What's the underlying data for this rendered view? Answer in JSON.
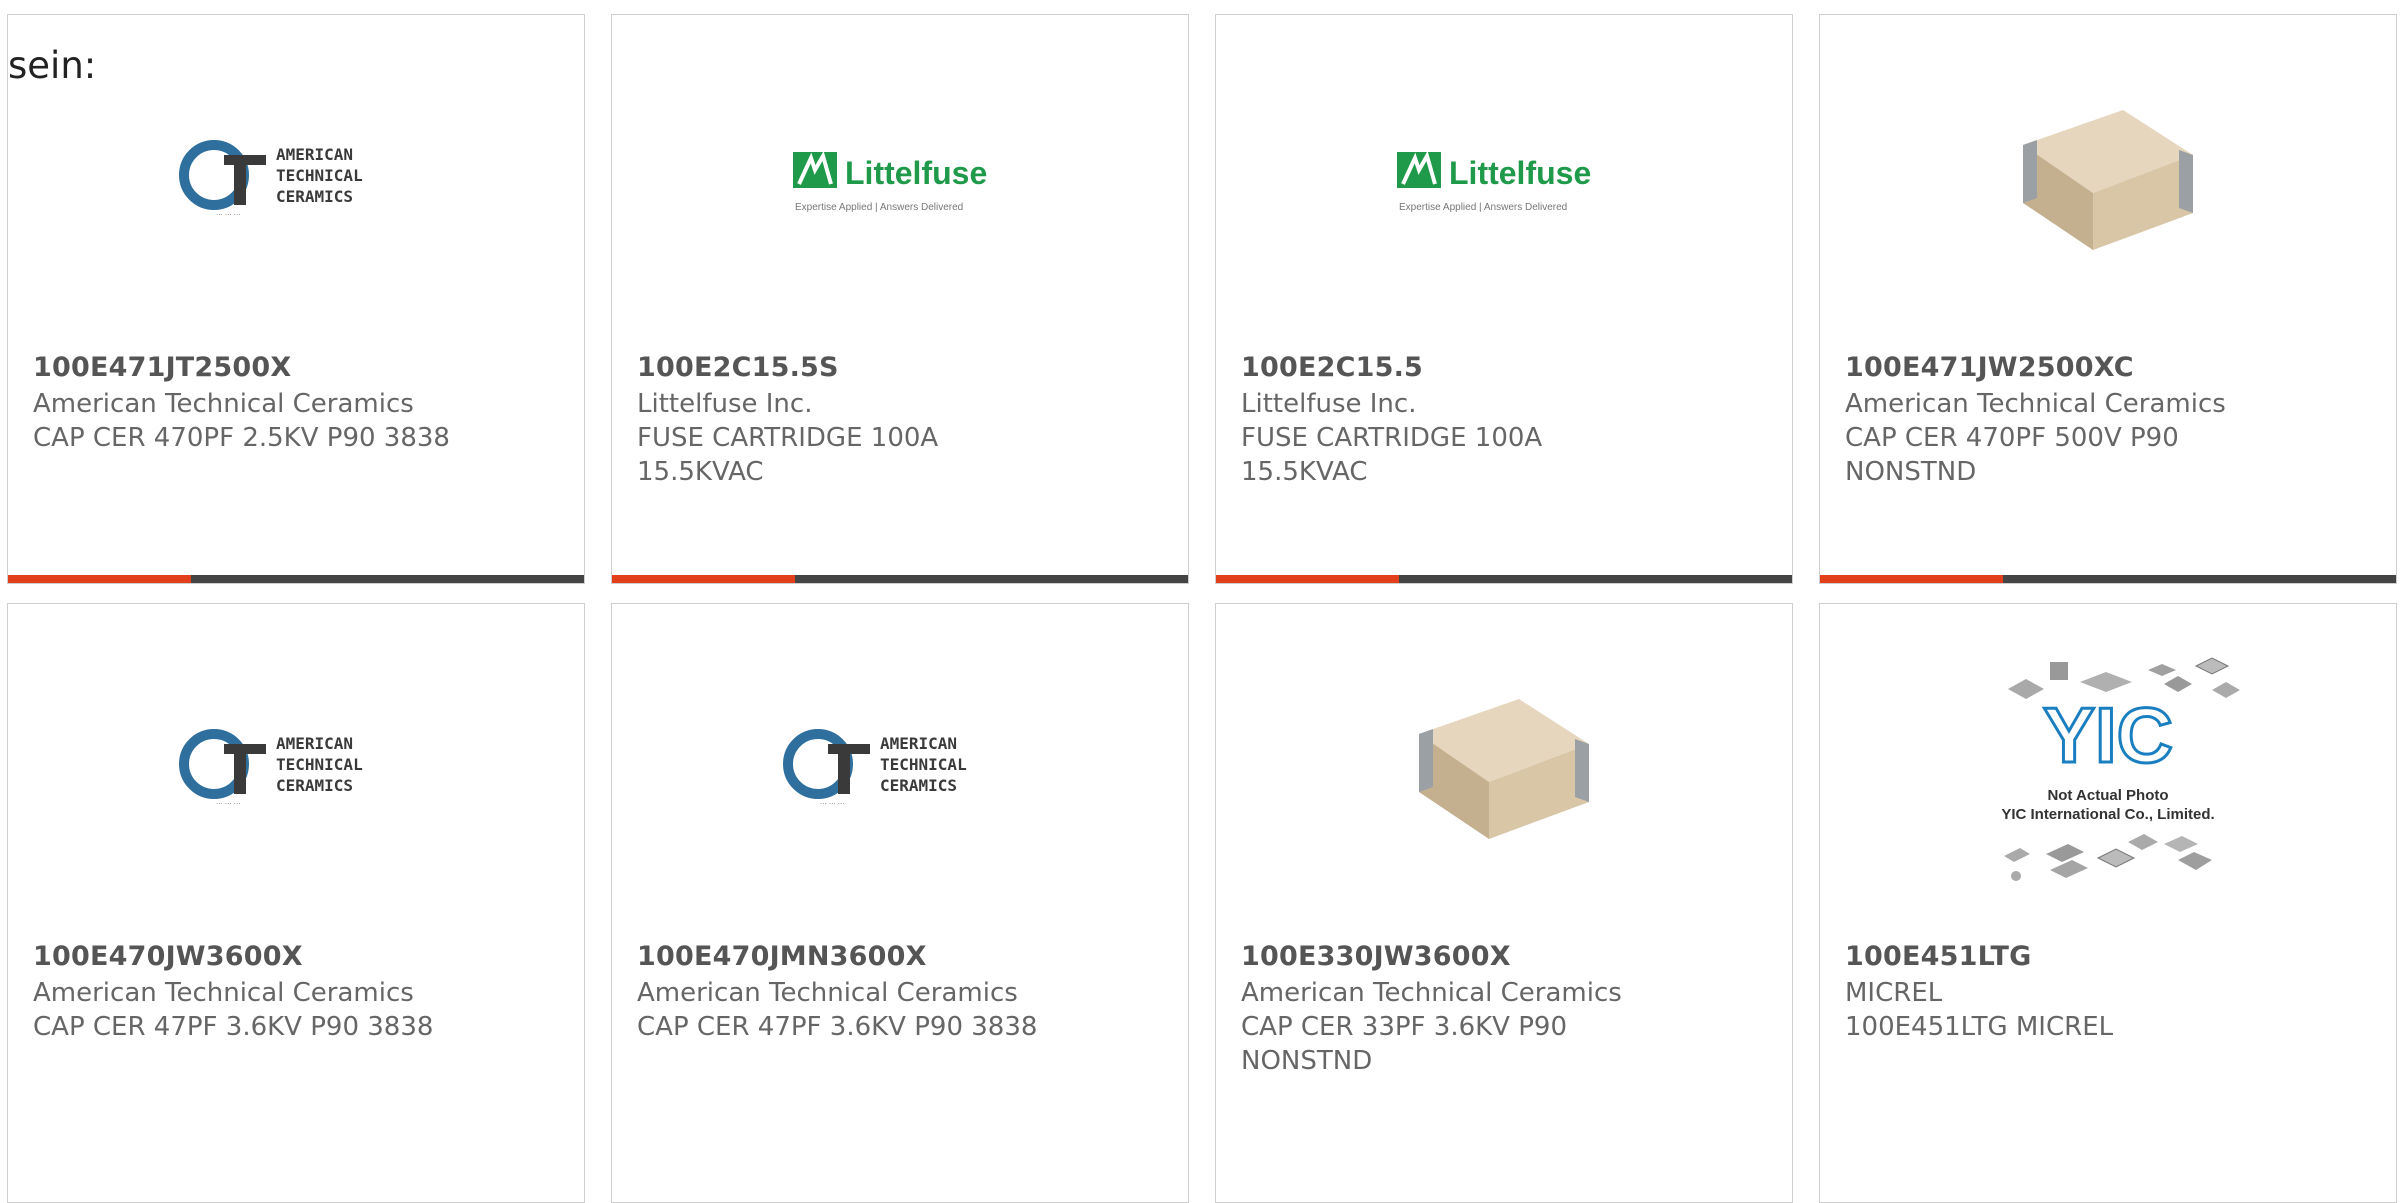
{
  "intro_text": "sein:",
  "products": [
    {
      "part_number": "100E471JT2500X",
      "manufacturer": "American Technical Ceramics",
      "desc_lines": [
        "CAP CER 470PF 2.5KV P90 3838"
      ],
      "image": "atc-logo"
    },
    {
      "part_number": "100E2C15.5S",
      "manufacturer": "Littelfuse Inc.",
      "desc_lines": [
        "FUSE CARTRIDGE 100A",
        "15.5KVAC"
      ],
      "image": "littelfuse-logo"
    },
    {
      "part_number": "100E2C15.5",
      "manufacturer": "Littelfuse Inc.",
      "desc_lines": [
        "FUSE CARTRIDGE 100A",
        "15.5KVAC"
      ],
      "image": "littelfuse-logo"
    },
    {
      "part_number": "100E471JW2500XC",
      "manufacturer": "American Technical Ceramics",
      "desc_lines": [
        "CAP CER 470PF 500V P90",
        "NONSTND"
      ],
      "image": "capacitor-photo"
    },
    {
      "part_number": "100E470JW3600X",
      "manufacturer": "American Technical Ceramics",
      "desc_lines": [
        "CAP CER 47PF 3.6KV P90 3838"
      ],
      "image": "atc-logo"
    },
    {
      "part_number": "100E470JMN3600X",
      "manufacturer": "American Technical Ceramics",
      "desc_lines": [
        "CAP CER 47PF 3.6KV P90 3838"
      ],
      "image": "atc-logo"
    },
    {
      "part_number": "100E330JW3600X",
      "manufacturer": "American Technical Ceramics",
      "desc_lines": [
        "CAP CER 33PF 3.6KV P90",
        "NONSTND"
      ],
      "image": "capacitor-photo"
    },
    {
      "part_number": "100E451LTG",
      "manufacturer": "MICREL",
      "desc_lines": [
        "100E451LTG MICREL"
      ],
      "image": "yic-placeholder"
    }
  ],
  "logos": {
    "atc_lines": [
      "AMERICAN",
      "TECHNICAL",
      "CERAMICS"
    ],
    "littelfuse_name": "Littelfuse",
    "littelfuse_tagline": "Expertise Applied | Answers Delivered",
    "yic_mark": "YIC",
    "yic_caption_lines": [
      "Not Actual Photo",
      "YIC International Co., Limited."
    ]
  },
  "colors": {
    "accent": "#e2401b",
    "bar_dark": "#444444",
    "border": "#cfcfcf",
    "atc_blue": "#2e6f9e",
    "littelfuse_green": "#1f9a4a",
    "yic_blue": "#1a7fc1"
  }
}
